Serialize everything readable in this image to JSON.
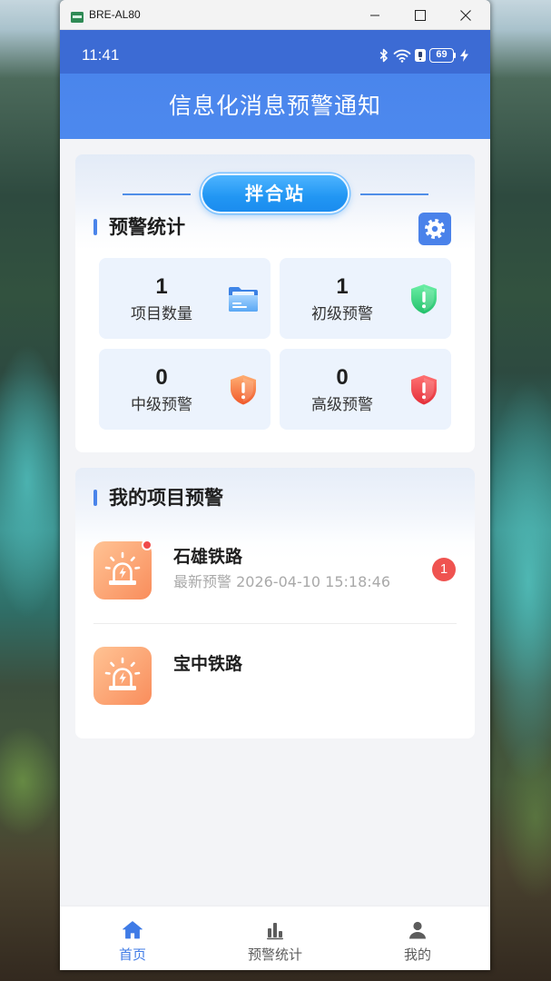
{
  "window": {
    "title": "BRE-AL80",
    "controls": [
      "minimize-icon",
      "maximize-icon",
      "close-icon"
    ]
  },
  "status_bar": {
    "time": "11:41",
    "battery_level": "69",
    "icons": [
      "bluetooth-icon",
      "wifi-icon",
      "status-indicator-icon",
      "battery-icon",
      "charging-icon"
    ]
  },
  "header": {
    "title": "信息化消息预警通知"
  },
  "station_selector": {
    "label": "拌合站"
  },
  "stats": {
    "title": "预警统计",
    "settings_icon": "gear-icon",
    "tiles": [
      {
        "value": "1",
        "label": "项目数量",
        "icon": "folder-icon"
      },
      {
        "value": "1",
        "label": "初级预警",
        "icon": "shield-green-icon"
      },
      {
        "value": "0",
        "label": "中级预警",
        "icon": "shield-orange-icon"
      },
      {
        "value": "0",
        "label": "高级预警",
        "icon": "shield-red-icon"
      }
    ]
  },
  "projects": {
    "title": "我的项目预警",
    "items": [
      {
        "name": "石雄铁路",
        "latest_alert": "最新预警 2026-04-10 15:18:46",
        "unread_badge": "1",
        "unread_dot": true,
        "icon": "alarm-light-icon"
      },
      {
        "name": "宝中铁路",
        "unread_dot": false,
        "icon": "alarm-light-icon"
      }
    ]
  },
  "bottom_nav": {
    "items": [
      {
        "label": "首页",
        "icon": "home-icon",
        "active": true
      },
      {
        "label": "预警统计",
        "icon": "bar-chart-icon",
        "active": false
      },
      {
        "label": "我的",
        "icon": "user-icon",
        "active": false
      }
    ]
  },
  "colors": {
    "primary": "#4a84ea",
    "status": "#3c6bd4",
    "header": "#4a85ec",
    "badge": "#ef5350",
    "nav-active": "#3f7be6",
    "nav-inactive": "#5c5c5c"
  }
}
